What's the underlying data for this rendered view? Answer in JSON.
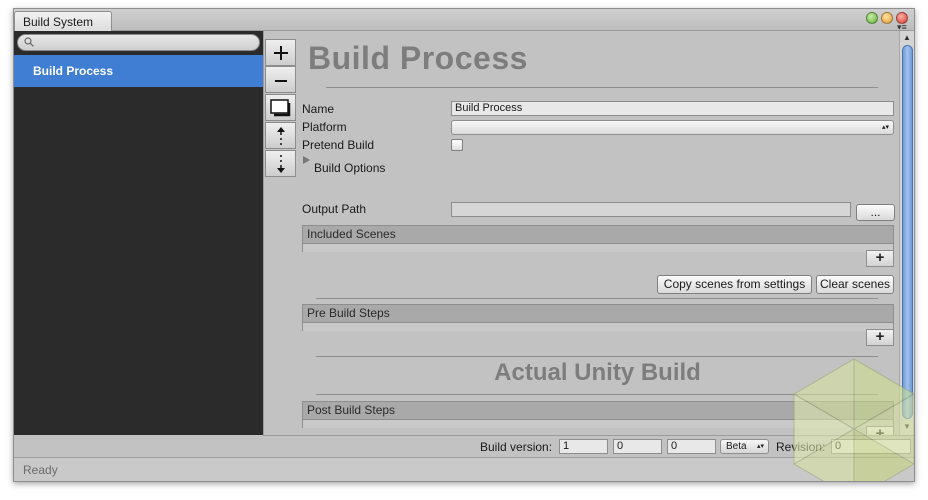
{
  "window": {
    "tab_title": "Build System",
    "colors": {
      "selection": "#3f7ed3",
      "panel_dark": "#2b2b2b",
      "background": "#c2c2c2"
    }
  },
  "sidebar": {
    "search_placeholder": "",
    "items": [
      {
        "label": "Build Process",
        "selected": true
      }
    ]
  },
  "toolbar": {
    "add_label": "+",
    "remove_label": "−"
  },
  "main": {
    "title": "Build Process",
    "fields": {
      "name_label": "Name",
      "name_value": "Build Process",
      "platform_label": "Platform",
      "platform_value": "",
      "pretend_build_label": "Pretend Build",
      "pretend_build_checked": false,
      "build_options_label": "Build Options",
      "output_path_label": "Output Path",
      "output_path_value": "",
      "browse_label": "..."
    },
    "included_scenes": {
      "header": "Included Scenes",
      "add_label": "+"
    },
    "scene_buttons": {
      "copy_label": "Copy scenes from settings",
      "clear_label": "Clear scenes"
    },
    "pre_build_steps": {
      "header": "Pre Build Steps",
      "add_label": "+"
    },
    "section_title": "Actual Unity Build",
    "post_build_steps": {
      "header": "Post Build Steps",
      "add_label": "+"
    }
  },
  "bottom": {
    "build_version_label": "Build version:",
    "major": "1",
    "minor": "0",
    "patch": "0",
    "channel": "Beta",
    "revision_label": "Revision:",
    "revision": "0"
  },
  "status": {
    "text": "Ready"
  }
}
